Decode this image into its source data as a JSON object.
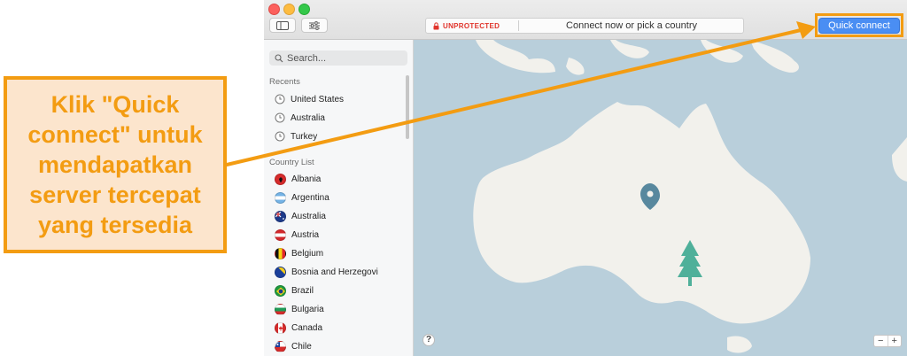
{
  "annotation": {
    "lines": [
      "Klik \"Quick",
      "connect\" untuk",
      "mendapatkan",
      "server tercepat",
      "yang tersedia"
    ]
  },
  "toolbar": {
    "status_label": "UNPROTECTED",
    "status_message": "Connect now or pick a country",
    "quick_connect_label": "Quick connect"
  },
  "sidebar": {
    "search_placeholder": "Search...",
    "recents_header": "Recents",
    "recents": [
      {
        "name": "United States"
      },
      {
        "name": "Australia"
      },
      {
        "name": "Turkey"
      }
    ],
    "country_list_header": "Country List",
    "countries": [
      {
        "name": "Albania",
        "flag": "albania-flag-icon"
      },
      {
        "name": "Argentina",
        "flag": "argentina-flag-icon"
      },
      {
        "name": "Australia",
        "flag": "australia-flag-icon"
      },
      {
        "name": "Austria",
        "flag": "austria-flag-icon"
      },
      {
        "name": "Belgium",
        "flag": "belgium-flag-icon"
      },
      {
        "name": "Bosnia and Herzegovi",
        "flag": "bosnia-flag-icon"
      },
      {
        "name": "Brazil",
        "flag": "brazil-flag-icon"
      },
      {
        "name": "Bulgaria",
        "flag": "bulgaria-flag-icon"
      },
      {
        "name": "Canada",
        "flag": "canada-flag-icon"
      },
      {
        "name": "Chile",
        "flag": "chile-flag-icon"
      }
    ]
  },
  "map": {
    "help_label": "?",
    "zoom_out_label": "−",
    "zoom_in_label": "+"
  },
  "colors": {
    "accent_orange": "#f39c12",
    "callout_bg": "#fce5cd",
    "quick_connect_blue": "#4a8ef3",
    "unprotected_red": "#e0342b",
    "map_water": "#b9cfdb",
    "map_land": "#f2f1ec",
    "map_pin": "#58889e",
    "tree_green": "#4fb09a"
  }
}
